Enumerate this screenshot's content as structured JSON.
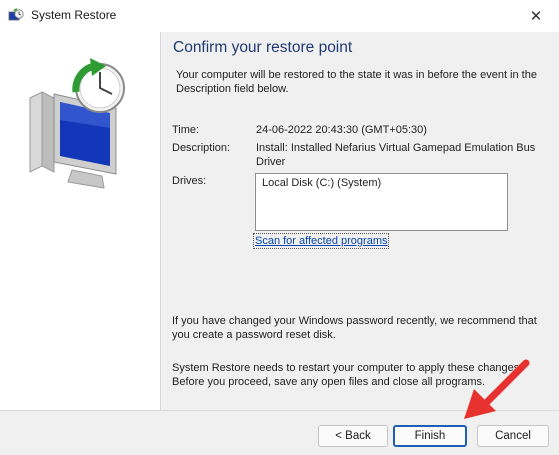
{
  "window": {
    "title": "System Restore",
    "close_glyph": "✕"
  },
  "dialog": {
    "heading": "Confirm your restore point",
    "intro": "Your computer will be restored to the state it was in before the event in the Description field below.",
    "time_label": "Time:",
    "time_value": "24-06-2022 20:43:30 (GMT+05:30)",
    "description_label": "Description:",
    "description_value": "Install: Installed Nefarius Virtual Gamepad Emulation Bus Driver",
    "drives_label": "Drives:",
    "drives_list": [
      "Local Disk (C:) (System)"
    ],
    "scan_link": "Scan for affected programs",
    "password_note": "If you have changed your Windows password recently, we recommend that you create a password reset disk.",
    "restart_note": "System Restore needs to restart your computer to apply these changes. Before you proceed, save any open files and close all programs."
  },
  "buttons": {
    "back": "< Back",
    "finish": "Finish",
    "cancel": "Cancel"
  },
  "icons": {
    "title_icon": "system-restore-icon",
    "sidebar_graphic": "computer-clock-restore-icon",
    "annotation": "red-arrow-icon"
  },
  "colors": {
    "heading": "#1f3a73",
    "link": "#0645ad",
    "focus": "#1c5fb3",
    "arrow": "#e8322f"
  }
}
